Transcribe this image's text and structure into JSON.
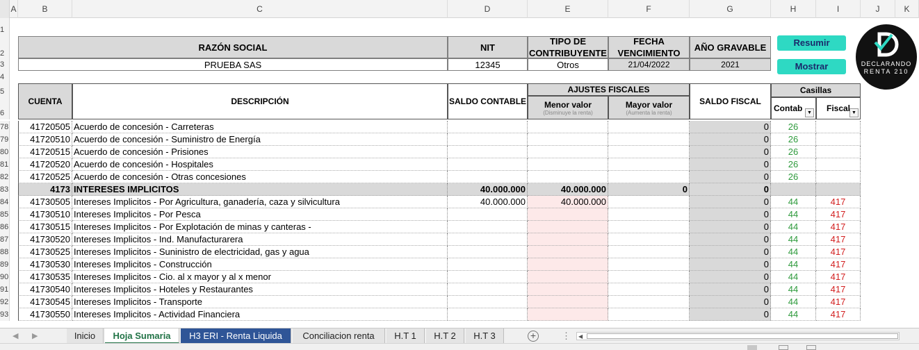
{
  "columns": [
    "A",
    "B",
    "C",
    "D",
    "E",
    "F",
    "G",
    "H",
    "I",
    "J",
    "K"
  ],
  "info": {
    "razon_social_label": "RAZÓN SOCIAL",
    "razon_social_value": "PRUEBA SAS",
    "nit_label": "NIT",
    "nit_value": "12345",
    "tipo_label": "TIPO DE CONTRIBUYENTE",
    "tipo_value": "Otros",
    "fecha_label": "FECHA VENCIMIENTO",
    "fecha_value": "21/04/2022",
    "anio_label": "AÑO GRAVABLE",
    "anio_value": "2021"
  },
  "buttons": {
    "resumir": "Resumir",
    "mostrar": "Mostrar"
  },
  "logo": {
    "line1": "DECLARANDO",
    "line2": "RENTA 210"
  },
  "table_header": {
    "cuenta": "CUENTA",
    "descripcion": "DESCRIPCIÓN",
    "saldo_contable": "SALDO CONTABLE",
    "ajustes": "AJUSTES FISCALES",
    "menor": "Menor valor",
    "menor_sub": "(Disminuye la renta)",
    "mayor": "Mayor valor",
    "mayor_sub": "(Aumenta la renta)",
    "saldo_fiscal": "SALDO FISCAL",
    "casillas": "Casillas",
    "contab": "Contab",
    "fiscal": "Fiscal"
  },
  "rows": [
    {
      "n": "78",
      "cuenta": "41720505",
      "desc": "Acuerdo de concesión - Carreteras",
      "sc": "",
      "me": "",
      "ma": "",
      "sf": "0",
      "h": "26",
      "i": "",
      "bold": false,
      "pink": false
    },
    {
      "n": "79",
      "cuenta": "41720510",
      "desc": "Acuerdo de concesión - Suministro de Energía",
      "sc": "",
      "me": "",
      "ma": "",
      "sf": "0",
      "h": "26",
      "i": "",
      "bold": false,
      "pink": false
    },
    {
      "n": "80",
      "cuenta": "41720515",
      "desc": "Acuerdo de concesión - Prisiones",
      "sc": "",
      "me": "",
      "ma": "",
      "sf": "0",
      "h": "26",
      "i": "",
      "bold": false,
      "pink": false
    },
    {
      "n": "81",
      "cuenta": "41720520",
      "desc": "Acuerdo de concesión - Hospitales",
      "sc": "",
      "me": "",
      "ma": "",
      "sf": "0",
      "h": "26",
      "i": "",
      "bold": false,
      "pink": false
    },
    {
      "n": "82",
      "cuenta": "41720525",
      "desc": "Acuerdo de concesión - Otras concesiones",
      "sc": "",
      "me": "",
      "ma": "",
      "sf": "0",
      "h": "26",
      "i": "",
      "bold": false,
      "pink": false
    },
    {
      "n": "83",
      "cuenta": "4173",
      "desc": "INTERESES IMPLICITOS",
      "sc": "40.000.000",
      "me": "40.000.000",
      "ma": "0",
      "sf": "0",
      "h": "",
      "i": "",
      "bold": true,
      "pink": false
    },
    {
      "n": "84",
      "cuenta": "41730505",
      "desc": "Intereses Implicitos - Por Agricultura, ganadería, caza y silvicultura",
      "sc": "40.000.000",
      "me": "40.000.000",
      "ma": "",
      "sf": "0",
      "h": "44",
      "i": "417",
      "bold": false,
      "pink": true
    },
    {
      "n": "85",
      "cuenta": "41730510",
      "desc": "Intereses Implicitos - Por Pesca",
      "sc": "",
      "me": "",
      "ma": "",
      "sf": "0",
      "h": "44",
      "i": "417",
      "bold": false,
      "pink": true
    },
    {
      "n": "86",
      "cuenta": "41730515",
      "desc": "Intereses Implicitos - Por Explotación de minas y canteras -",
      "sc": "",
      "me": "",
      "ma": "",
      "sf": "0",
      "h": "44",
      "i": "417",
      "bold": false,
      "pink": true
    },
    {
      "n": "87",
      "cuenta": "41730520",
      "desc": "Intereses Implicitos - Ind. Manufacturarera",
      "sc": "",
      "me": "",
      "ma": "",
      "sf": "0",
      "h": "44",
      "i": "417",
      "bold": false,
      "pink": true
    },
    {
      "n": "88",
      "cuenta": "41730525",
      "desc": "Intereses Implicitos - Suninistro de electricidad, gas y agua",
      "sc": "",
      "me": "",
      "ma": "",
      "sf": "0",
      "h": "44",
      "i": "417",
      "bold": false,
      "pink": true
    },
    {
      "n": "89",
      "cuenta": "41730530",
      "desc": "Intereses Implicitos - Construcción",
      "sc": "",
      "me": "",
      "ma": "",
      "sf": "0",
      "h": "44",
      "i": "417",
      "bold": false,
      "pink": true
    },
    {
      "n": "90",
      "cuenta": "41730535",
      "desc": "Intereses Implicitos - Cio. al x mayor y al x menor",
      "sc": "",
      "me": "",
      "ma": "",
      "sf": "0",
      "h": "44",
      "i": "417",
      "bold": false,
      "pink": true
    },
    {
      "n": "91",
      "cuenta": "41730540",
      "desc": "Intereses Implicitos - Hoteles y Restaurantes",
      "sc": "",
      "me": "",
      "ma": "",
      "sf": "0",
      "h": "44",
      "i": "417",
      "bold": false,
      "pink": true
    },
    {
      "n": "92",
      "cuenta": "41730545",
      "desc": "Intereses Implicitos - Transporte",
      "sc": "",
      "me": "",
      "ma": "",
      "sf": "0",
      "h": "44",
      "i": "417",
      "bold": false,
      "pink": true
    },
    {
      "n": "93",
      "cuenta": "41730550",
      "desc": "Intereses Implicitos - Actividad Financiera",
      "sc": "",
      "me": "",
      "ma": "",
      "sf": "0",
      "h": "44",
      "i": "417",
      "bold": false,
      "pink": true
    }
  ],
  "sheet_tabs": [
    "Inicio",
    "Hoja Sumaria",
    "H3 ERI - Renta Liquida",
    "Conciliacion renta",
    "H.T 1",
    "H.T 2",
    "H.T 3"
  ],
  "active_tab": "Hoja Sumaria",
  "colors": {
    "accent_button": "#2ed9c3",
    "header_gray": "#d9d9d9",
    "green": "#2e9a3c",
    "red": "#d21f1f",
    "tab_blue": "#2f5597"
  }
}
